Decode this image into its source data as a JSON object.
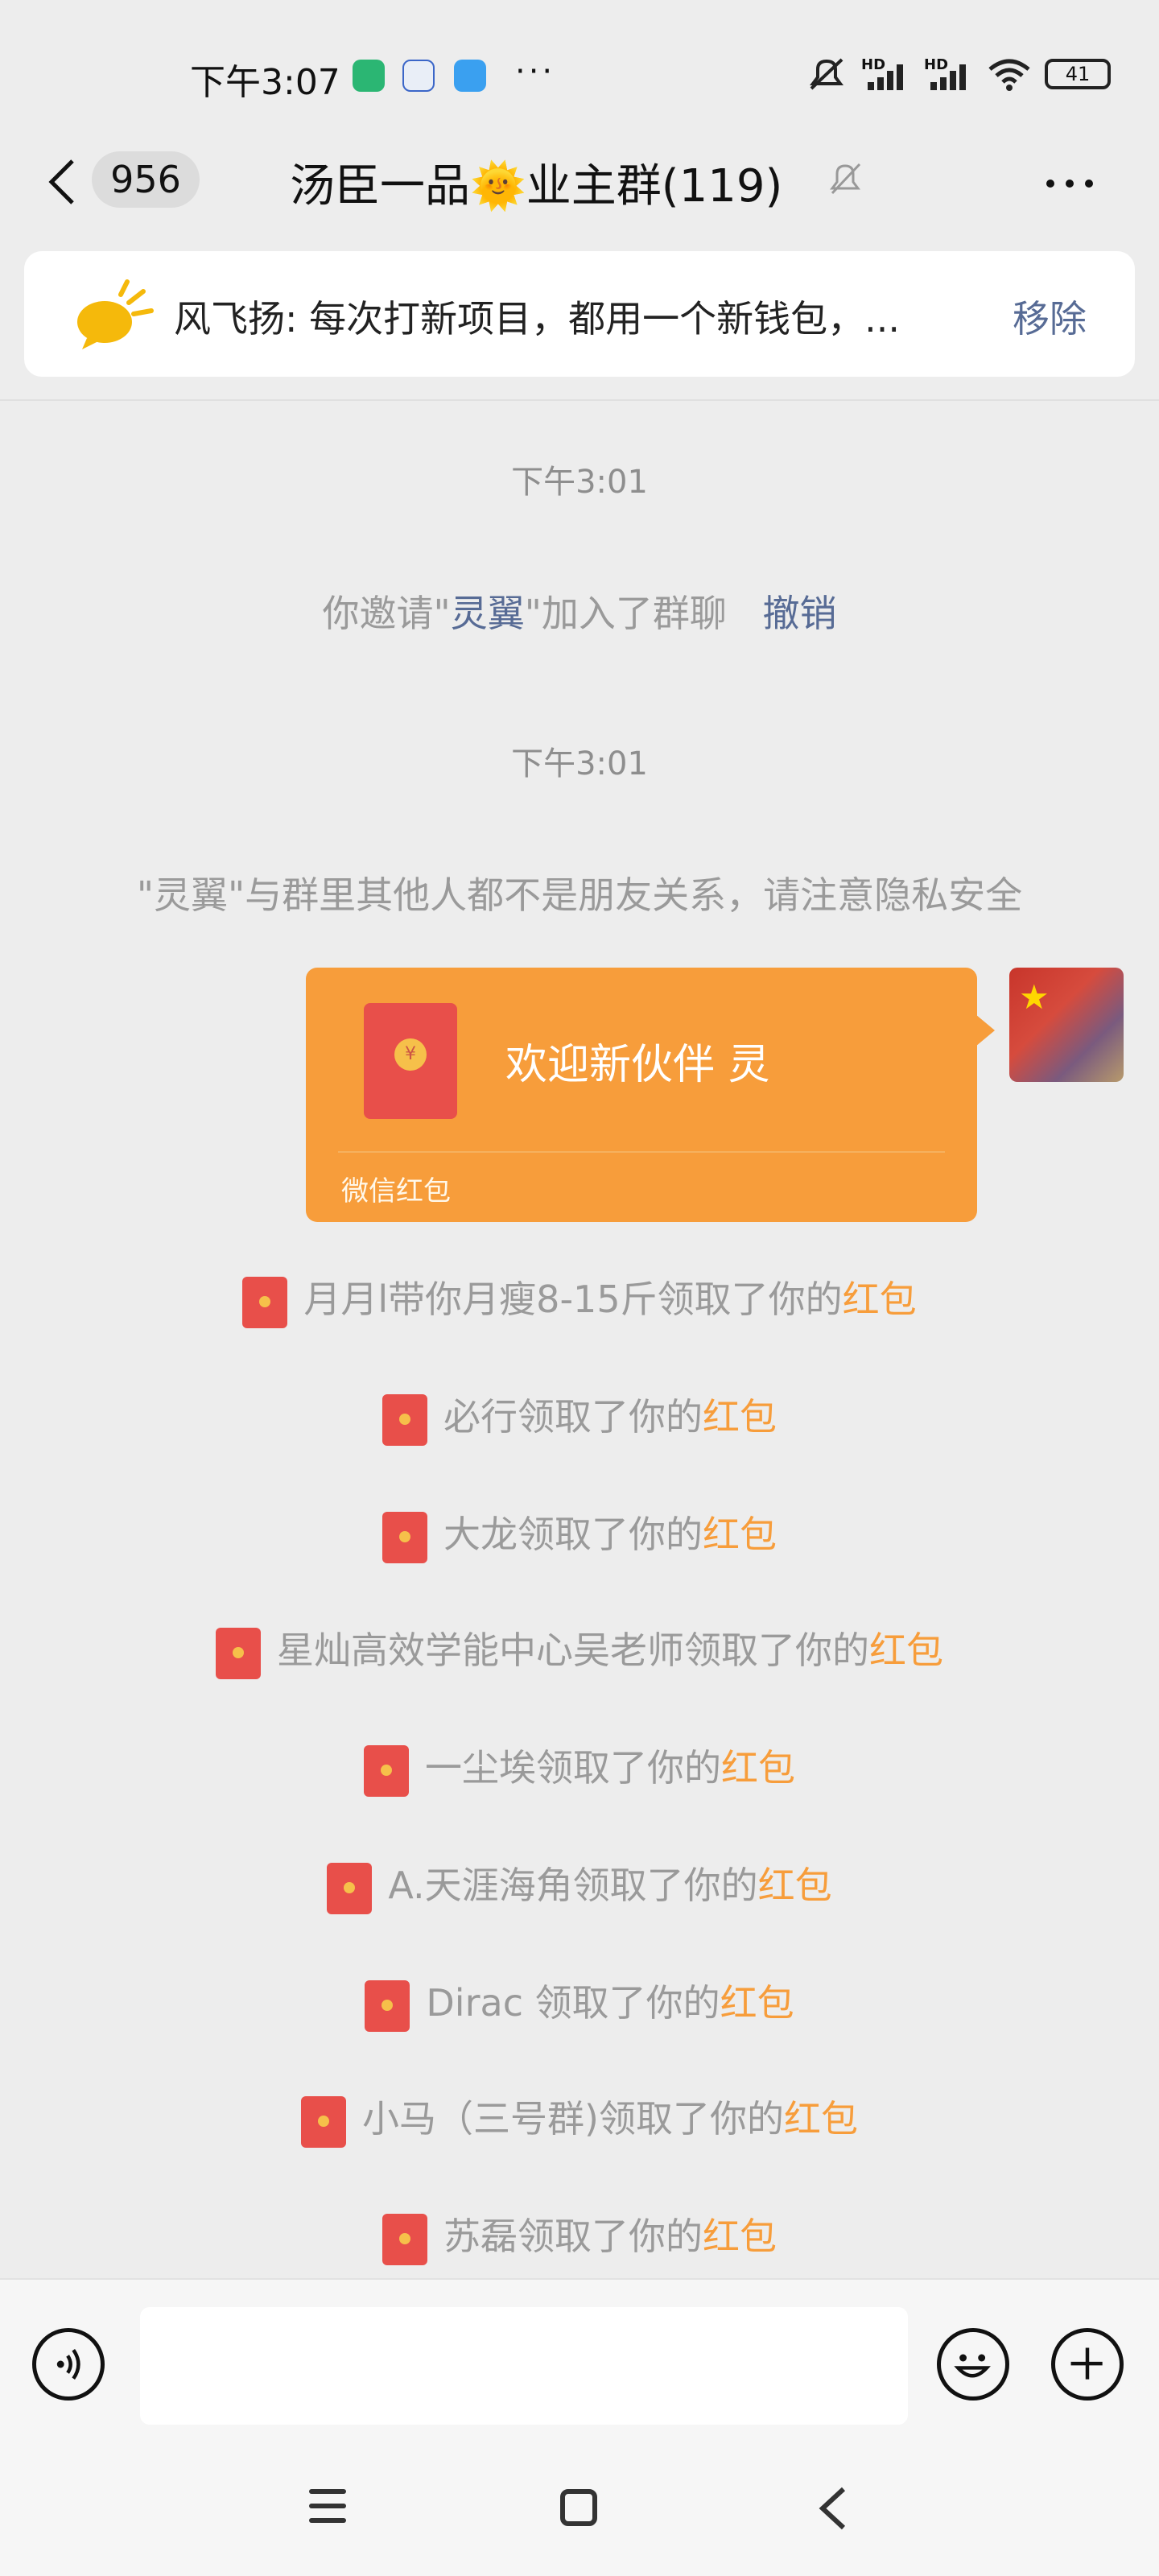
{
  "status_bar": {
    "time": "下午3:07",
    "more_dots": "···",
    "battery": "41",
    "network_labels": [
      "HD",
      "HD"
    ]
  },
  "header": {
    "unread_count": "956",
    "title": "汤臣一品🌞业主群(119)"
  },
  "pinned_notice": {
    "text": "风飞扬: 每次打新项目，都用一个新钱包，...",
    "remove_label": "移除"
  },
  "chat": {
    "time_1": "下午3:01",
    "invite_prefix": "你邀请\"",
    "invite_name": "灵翼",
    "invite_suffix": "\"加入了群聊",
    "invite_undo": "撤销",
    "time_2": "下午3:01",
    "privacy_notice": "\"灵翼\"与群里其他人都不是朋友关系，请注意隐私安全",
    "red_packet": {
      "title": "欢迎新伙伴  灵",
      "footer": "微信红包",
      "coin_glyph": "¥"
    },
    "claim_suffix": "领取了你的",
    "red_packet_word": "红包",
    "claims": [
      {
        "name": "月月l带你月瘦8-15斤"
      },
      {
        "name": "必行"
      },
      {
        "name": "大龙"
      },
      {
        "name": "星灿高效学能中心吴老师"
      },
      {
        "name": "一尘埃"
      },
      {
        "name": "A.天涯海角"
      },
      {
        "name": "Dirac "
      },
      {
        "name": "小马（三号群)"
      },
      {
        "name": "苏磊"
      }
    ]
  },
  "input_bar": {
    "message_value": ""
  },
  "colors": {
    "background": "#ededed",
    "red_packet_orange": "#f79d3b",
    "link_blue": "#576b95",
    "system_gray": "#9a9a9a"
  },
  "icons": [
    "back-icon",
    "mute-bell-icon",
    "more-icon",
    "notice-speaker-icon",
    "voice-icon",
    "emoji-icon",
    "plus-icon",
    "nav-menu-icon",
    "nav-home-icon",
    "nav-back-icon"
  ]
}
